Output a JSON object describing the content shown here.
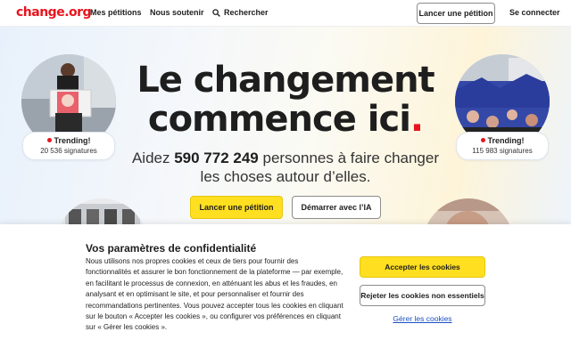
{
  "header": {
    "logo": "change.org",
    "nav": {
      "my_petitions": "Mes pétitions",
      "support": "Nous soutenir",
      "search": "Rechercher"
    },
    "launch_button": "Lancer une pétition",
    "connect_button": "Se connecter"
  },
  "hero": {
    "headline_line1": "Le changement",
    "headline_line2": "commence ici",
    "headline_dot": ".",
    "sub_prefix": "Aidez ",
    "sub_count": "590 772 249",
    "sub_suffix": " personnes à faire changer",
    "sub_line2": "les choses autour d’elles.",
    "primary_button": "Lancer une pétition",
    "secondary_button": "Démarrer avec l’IA",
    "trending_left": {
      "label": "Trending!",
      "signatures": "20 536 signatures"
    },
    "trending_right": {
      "label": "Trending!",
      "signatures": "115 983 signatures"
    }
  },
  "cookie": {
    "title": "Vos paramètres de confidentialité",
    "body": "Nous utilisons nos propres cookies et ceux de tiers pour fournir des fonctionnalités et assurer le bon fonctionnement de la plateforme — par exemple, en facilitant le processus de connexion, en atténuant les abus et les fraudes, en analysant et en optimisant le site, et pour personnaliser et fournir des recommandations pertinentes. Vous pouvez accepter tous les cookies en cliquant sur le bouton « Accepter les cookies », ou configurer vos préférences en cliquant sur « Gérer les cookies ».",
    "accept": "Accepter les cookies",
    "reject": "Rejeter les cookies non essentiels",
    "manage": "Gérer les cookies"
  },
  "colors": {
    "brand_red": "#e8141e",
    "accent_yellow": "#ffdf20",
    "link_blue": "#1a4fc4"
  },
  "icons": {
    "search": "search-icon",
    "trending": "red-dot-icon"
  }
}
